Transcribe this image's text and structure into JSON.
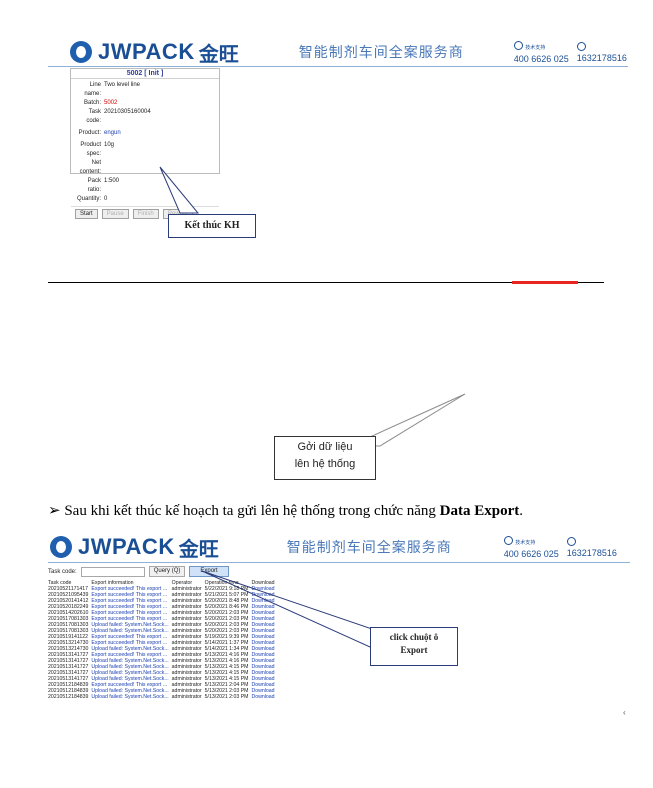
{
  "header1": {
    "brand_en": "JWPACK",
    "brand_cn": "金旺",
    "tagline": "智能制剂车间全案服务商",
    "hotline_label": "技术支持",
    "hotline": "400 6626 025",
    "mobile": "1632178516"
  },
  "panel": {
    "title": "5002 [ Init ]",
    "fields": [
      {
        "label": "Line name:",
        "value": "Two level line"
      },
      {
        "label": "Batch:",
        "value": "5002"
      },
      {
        "label": "Task code:",
        "value": "20210305160004"
      },
      {
        "label": "Product:",
        "value": "engun"
      },
      {
        "label": "Product spec:",
        "value": "10g"
      },
      {
        "label": "Net content:",
        "value": ""
      },
      {
        "label": "Pack ratio:",
        "value": "1:500"
      },
      {
        "label": "Quantity:",
        "value": "0"
      }
    ],
    "buttons": [
      "Start",
      "Pause",
      "Finish",
      "Rework"
    ]
  },
  "callouts": {
    "finish_plan": "Kết thúc KH",
    "send_data_1": "Gởi dữ liệu",
    "send_data_2": "lên hệ thống",
    "click_export_1": "click chuột ô",
    "click_export_2": "Export"
  },
  "bullet": {
    "arrow": "➢",
    "text": "Sau khi kết thúc kế hoạch ta gửi lên hệ thống trong chức năng ",
    "bold": "Data Export",
    "end": "."
  },
  "header2": {
    "brand_en": "JWPACK",
    "brand_cn": "金旺",
    "tagline": "智能制剂车间全案服务商",
    "hotline_label": "技术支持",
    "hotline": "400 6626 025",
    "mobile": "1632178516"
  },
  "export_ui": {
    "task_code_label": "Task code:",
    "query_label": "Query (Q)",
    "export_label": "Export",
    "columns": [
      "Task code",
      "Export information",
      "Operator",
      "Operation time",
      "Download"
    ],
    "rows": [
      [
        "20210521171417",
        "Export succeeded! This export ...",
        "administrator",
        "5/22/2021 9:18 PM",
        "Download"
      ],
      [
        "20210521095439",
        "Export succeeded! This export ...",
        "administrator",
        "5/21/2021 5:07 PM",
        "Download"
      ],
      [
        "20210520141412",
        "Export succeeded! This export ...",
        "administrator",
        "5/20/2021 8:48 PM",
        "Download"
      ],
      [
        "20210520182249",
        "Export succeeded! This export ...",
        "administrator",
        "5/20/2021 8:46 PM",
        "Download"
      ],
      [
        "20210514202610",
        "Export succeeded! This export ...",
        "administrator",
        "5/20/2021 2:03 PM",
        "Download"
      ],
      [
        "20210517081303",
        "Export succeeded! This export ...",
        "administrator",
        "5/20/2021 2:03 PM",
        "Download"
      ],
      [
        "20210517081303",
        "Upload failed: System.Net.Sock...",
        "administrator",
        "5/20/2021 2:03 PM",
        "Download"
      ],
      [
        "20210517081303",
        "Upload failed: System.Net.Sock...",
        "administrator",
        "5/20/2021 2:03 PM",
        "Download"
      ],
      [
        "20210519141122",
        "Export succeeded! This export ...",
        "administrator",
        "5/19/2021 9:39 PM",
        "Download"
      ],
      [
        "20210513214730",
        "Export succeeded! This export ...",
        "administrator",
        "5/14/2021 1:37 PM",
        "Download"
      ],
      [
        "20210513214730",
        "Upload failed: System.Net.Sock...",
        "administrator",
        "5/14/2021 1:34 PM",
        "Download"
      ],
      [
        "20210513141727",
        "Export succeeded! This export ...",
        "administrator",
        "5/13/2021 4:16 PM",
        "Download"
      ],
      [
        "20210513141727",
        "Upload failed: System.Net.Sock...",
        "administrator",
        "5/13/2021 4:16 PM",
        "Download"
      ],
      [
        "20210513141727",
        "Upload failed: System.Net.Sock...",
        "administrator",
        "5/13/2021 4:15 PM",
        "Download"
      ],
      [
        "20210513141727",
        "Upload failed: System.Net.Sock...",
        "administrator",
        "5/13/2021 4:15 PM",
        "Download"
      ],
      [
        "20210513141727",
        "Upload failed: System.Net.Sock...",
        "administrator",
        "5/13/2021 4:15 PM",
        "Download"
      ],
      [
        "20210512184839",
        "Export succeeded! This export ...",
        "administrator",
        "5/13/2021 2:04 PM",
        "Download"
      ],
      [
        "20210512184839",
        "Upload failed: System.Net.Sock...",
        "administrator",
        "5/13/2021 2:03 PM",
        "Download"
      ],
      [
        "20210512184839",
        "Upload failed: System.Net.Sock...",
        "administrator",
        "5/13/2021 2:03 PM",
        "Download"
      ]
    ],
    "side_button": "‹"
  },
  "colors": {
    "brand_blue": "#1b4f95",
    "accent_red": "#e8261f",
    "link_blue": "#1a3fb0"
  }
}
